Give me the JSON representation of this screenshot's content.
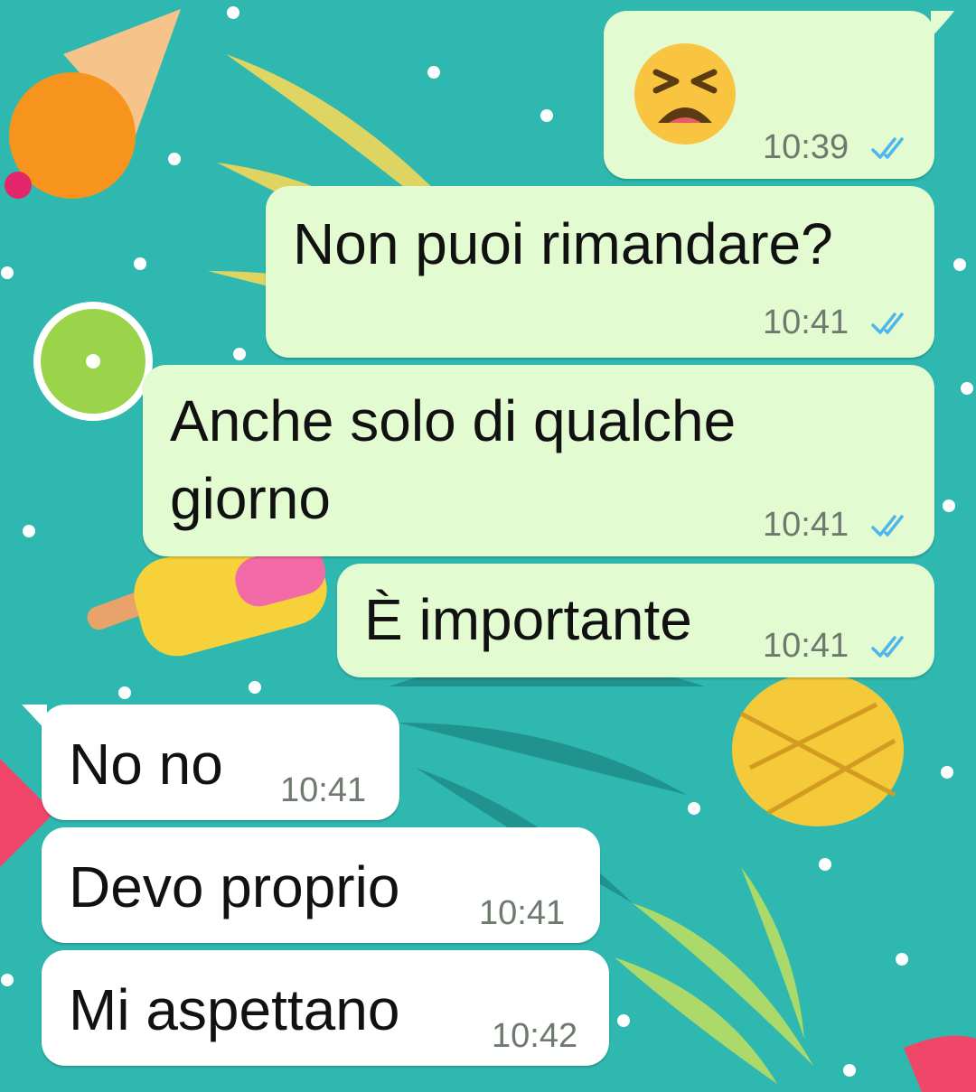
{
  "chat": {
    "messages": [
      {
        "direction": "out",
        "type": "emoji",
        "emoji": "tired-face",
        "time": "10:39",
        "status": "read"
      },
      {
        "direction": "out",
        "text": "Non puoi rimandare?",
        "time": "10:41",
        "status": "read"
      },
      {
        "direction": "out",
        "text_line1": "Anche solo di qualche",
        "text_line2": "giorno",
        "time": "10:41",
        "status": "read"
      },
      {
        "direction": "out",
        "text": "È importante",
        "time": "10:41",
        "status": "read"
      },
      {
        "direction": "in",
        "text": "No no",
        "time": "10:41"
      },
      {
        "direction": "in",
        "text": "Devo proprio",
        "time": "10:41"
      },
      {
        "direction": "in",
        "text": "Mi aspettano",
        "time": "10:42"
      }
    ]
  },
  "colors": {
    "wallpaper": "#2fb8b0",
    "outgoing_bubble": "#e2fbd1",
    "incoming_bubble": "#ffffff",
    "read_ticks": "#4fb6ec",
    "timestamp": "#6e7a6e"
  }
}
